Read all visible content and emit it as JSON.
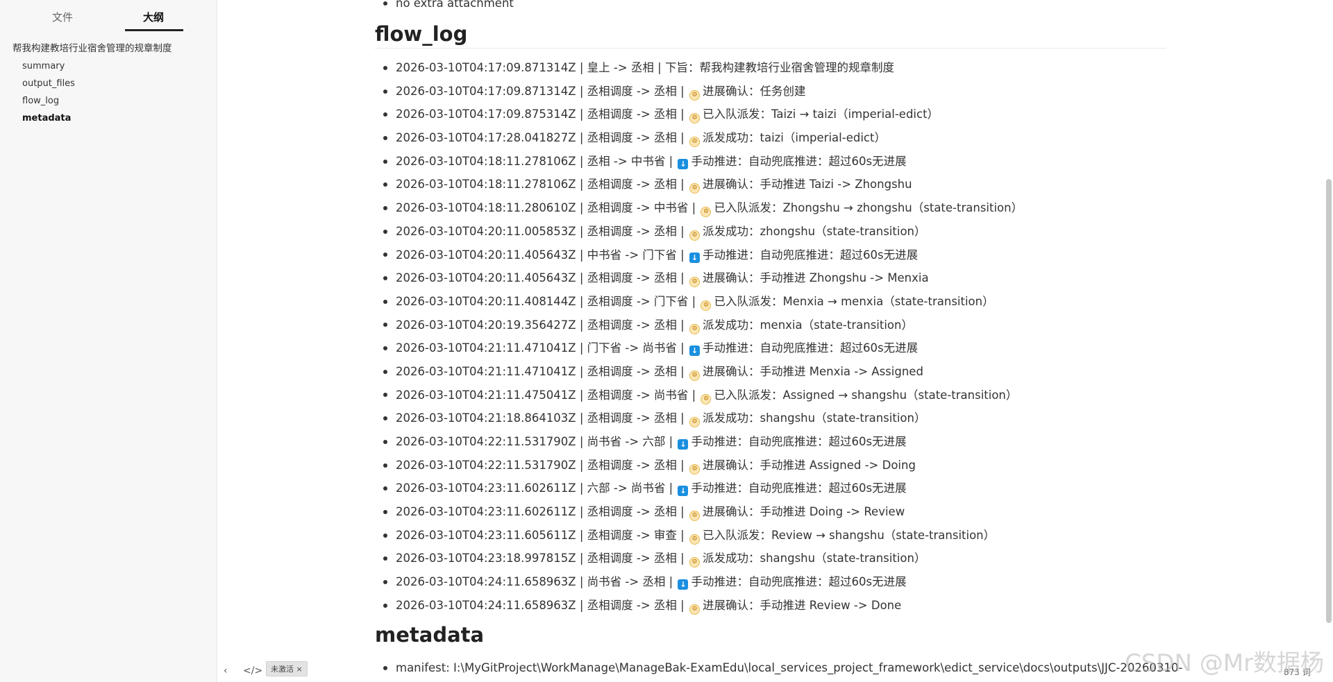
{
  "sidebar": {
    "tabs": [
      "文件",
      "大纲"
    ],
    "outline": [
      {
        "label": "帮我构建教培行业宿舍管理的规章制度",
        "level": 1,
        "bold": false
      },
      {
        "label": "summary",
        "level": 2,
        "bold": false
      },
      {
        "label": "output_files",
        "level": 2,
        "bold": false
      },
      {
        "label": "flow_log",
        "level": 2,
        "bold": false
      },
      {
        "label": "metadata",
        "level": 2,
        "bold": true
      }
    ],
    "footer": {
      "back_icon": "‹",
      "code_icon": "</>",
      "badge": "未激活 ×"
    }
  },
  "main": {
    "top_item": "no extra attachment",
    "flow_log_heading": "flow_log",
    "flow_log": [
      {
        "pre": "2026-03-10T04:17:09.871314Z | 皇上 -> 丞相 | 下旨：帮我构建教培行业宿舍管理的规章制度",
        "icon": "",
        "post": ""
      },
      {
        "pre": "2026-03-10T04:17:09.871314Z | 丞相调度 -> 丞相 |",
        "icon": "gear",
        "post": "进展确认：任务创建"
      },
      {
        "pre": "2026-03-10T04:17:09.875314Z | 丞相调度 -> 丞相 |",
        "icon": "gear",
        "post": "已入队派发：Taizi → taizi（imperial-edict）"
      },
      {
        "pre": "2026-03-10T04:17:28.041827Z | 丞相调度 -> 丞相 |",
        "icon": "gear",
        "post": "派发成功：taizi（imperial-edict）"
      },
      {
        "pre": "2026-03-10T04:18:11.278106Z | 丞相 -> 中书省 |",
        "icon": "down",
        "post": "手动推进：自动兜底推进：超过60s无进展"
      },
      {
        "pre": "2026-03-10T04:18:11.278106Z | 丞相调度 -> 丞相 |",
        "icon": "gear",
        "post": "进展确认：手动推进 Taizi -> Zhongshu"
      },
      {
        "pre": "2026-03-10T04:18:11.280610Z | 丞相调度 -> 中书省 |",
        "icon": "gear",
        "post": "已入队派发：Zhongshu → zhongshu（state-transition）"
      },
      {
        "pre": "2026-03-10T04:20:11.005853Z | 丞相调度 -> 丞相 |",
        "icon": "gear",
        "post": "派发成功：zhongshu（state-transition）"
      },
      {
        "pre": "2026-03-10T04:20:11.405643Z | 中书省 -> 门下省 |",
        "icon": "down",
        "post": "手动推进：自动兜底推进：超过60s无进展"
      },
      {
        "pre": "2026-03-10T04:20:11.405643Z | 丞相调度 -> 丞相 |",
        "icon": "gear",
        "post": "进展确认：手动推进 Zhongshu -> Menxia"
      },
      {
        "pre": "2026-03-10T04:20:11.408144Z | 丞相调度 -> 门下省 |",
        "icon": "gear",
        "post": "已入队派发：Menxia → menxia（state-transition）"
      },
      {
        "pre": "2026-03-10T04:20:19.356427Z | 丞相调度 -> 丞相 |",
        "icon": "gear",
        "post": "派发成功：menxia（state-transition）"
      },
      {
        "pre": "2026-03-10T04:21:11.471041Z | 门下省 -> 尚书省 |",
        "icon": "down",
        "post": "手动推进：自动兜底推进：超过60s无进展"
      },
      {
        "pre": "2026-03-10T04:21:11.471041Z | 丞相调度 -> 丞相 |",
        "icon": "gear",
        "post": "进展确认：手动推进 Menxia -> Assigned"
      },
      {
        "pre": "2026-03-10T04:21:11.475041Z | 丞相调度 -> 尚书省 |",
        "icon": "gear",
        "post": "已入队派发：Assigned → shangshu（state-transition）"
      },
      {
        "pre": "2026-03-10T04:21:18.864103Z | 丞相调度 -> 丞相 |",
        "icon": "gear",
        "post": "派发成功：shangshu（state-transition）"
      },
      {
        "pre": "2026-03-10T04:22:11.531790Z | 尚书省 -> 六部 |",
        "icon": "down",
        "post": "手动推进：自动兜底推进：超过60s无进展"
      },
      {
        "pre": "2026-03-10T04:22:11.531790Z | 丞相调度 -> 丞相 |",
        "icon": "gear",
        "post": "进展确认：手动推进 Assigned -> Doing"
      },
      {
        "pre": "2026-03-10T04:23:11.602611Z | 六部 -> 尚书省 |",
        "icon": "down",
        "post": "手动推进：自动兜底推进：超过60s无进展"
      },
      {
        "pre": "2026-03-10T04:23:11.602611Z | 丞相调度 -> 丞相 |",
        "icon": "gear",
        "post": "进展确认：手动推进 Doing -> Review"
      },
      {
        "pre": "2026-03-10T04:23:11.605611Z | 丞相调度 -> 审查 |",
        "icon": "gear",
        "post": "已入队派发：Review → shangshu（state-transition）"
      },
      {
        "pre": "2026-03-10T04:23:18.997815Z | 丞相调度 -> 丞相 |",
        "icon": "gear",
        "post": "派发成功：shangshu（state-transition）"
      },
      {
        "pre": "2026-03-10T04:24:11.658963Z | 尚书省 -> 丞相 |",
        "icon": "down",
        "post": "手动推进：自动兜底推进：超过60s无进展"
      },
      {
        "pre": "2026-03-10T04:24:11.658963Z | 丞相调度 -> 丞相 |",
        "icon": "gear",
        "post": "进展确认：手动推进 Review -> Done"
      }
    ],
    "metadata_heading": "metadata",
    "metadata": [
      "manifest: I:\\MyGitProject\\WorkManage\\ManageBak-ExamEdu\\local_services_project_framework\\edict_service\\docs\\outputs\\JJC-20260310-"
    ]
  },
  "status": {
    "word_count": "873 词"
  },
  "watermark": "CSDN @Mr数据杨"
}
